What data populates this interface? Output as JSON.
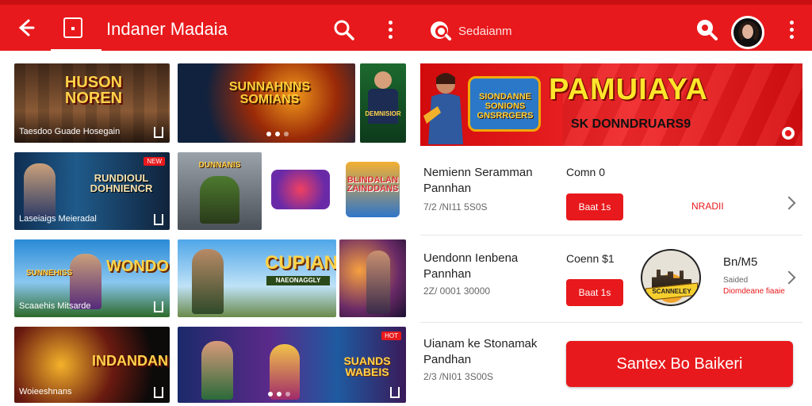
{
  "header": {
    "title": "Indaner Madaia",
    "search_label": "Sedaianm"
  },
  "tiles": [
    {
      "title": "HUSON NOREN",
      "caption": "Taesdoo   Guade Hosegain"
    },
    {
      "title": "SUNNAHNNS SOMIANS",
      "caption": ""
    },
    {
      "title": "DEMNISIOR",
      "caption": ""
    },
    {
      "title": "RUNDIOUL DOHNIENCR",
      "caption": "Laseiaigs Meieradal",
      "tag": "NEW"
    },
    {
      "title": "DUNNANIS",
      "caption": ""
    },
    {
      "title": "BLINDALAN ZAINDDANS",
      "caption": ""
    },
    {
      "title": "WONDOM",
      "caption": "Scaaehis Mitsarde",
      "sub": "SUNNEHISS"
    },
    {
      "title": "CUPIAN",
      "sub": "NAEONAGGLY",
      "caption": ""
    },
    {
      "title": "",
      "caption": ""
    },
    {
      "title": "INDANDAN",
      "caption": "Woieeshnans"
    },
    {
      "title": "SUANDS WABEIS",
      "caption": "",
      "tag": "HOT"
    }
  ],
  "banner": {
    "title": "PAMUIAYA",
    "subtitle": "SK DONNDRUARS9",
    "logo_text": "SIONDANNE SONIONS GNSRRGERS"
  },
  "list": [
    {
      "name": "Nemienn Seramman Pannhan",
      "meta": "7/2 /NI11 5S0S",
      "count": "Comn 0",
      "button": "Baat 1s",
      "red_text": "NRADII"
    },
    {
      "name": "Uendonn Ienbena Pannhan",
      "meta": "2Z/ 0001 30000",
      "count": "Coenn $1",
      "button": "Baat 1s",
      "side_title": "Bn/M5",
      "side_sub": "Saided",
      "side_sub2": "Diomdeane fiaaie",
      "badge_text": "SCANNELEY"
    },
    {
      "name": "Uianam ke Stonamak Pandhan",
      "meta": "2/3 /NI01 3S00S"
    }
  ],
  "action_button": "Santex Bo Baikeri",
  "colors": {
    "accent": "#e8191c",
    "banner_title": "#ffe52b"
  },
  "icons": [
    "back-arrow-icon",
    "book-icon",
    "search-icon",
    "more-vert-icon",
    "avatar",
    "chevron-right-icon",
    "bookmark-icon"
  ]
}
